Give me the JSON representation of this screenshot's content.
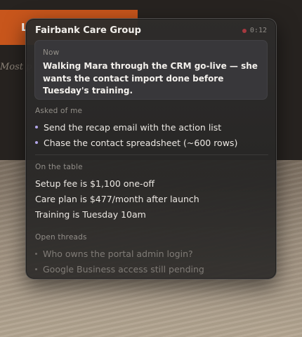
{
  "background": {
    "cta_label": "L",
    "tagline": "Most p"
  },
  "panel": {
    "title": "Fairbank Care Group",
    "timer": "0:12",
    "recording_color": "#a6393f",
    "accent_bullet_color": "#b2a6e8",
    "now": {
      "label": "Now",
      "text": "Walking Mara through the CRM go-live — she wants the contact import done before Tuesday's training."
    },
    "asked_of_me": {
      "label": "Asked of me",
      "items": [
        "Send the recap email with the action list",
        "Chase the contact spreadsheet (~600 rows)"
      ]
    },
    "on_the_table": {
      "label": "On the table",
      "items": [
        "Setup fee is $1,100 one-off",
        "Care plan is $477/month after launch",
        "Training is Tuesday 10am"
      ]
    },
    "open_threads": {
      "label": "Open threads",
      "items": [
        "Who owns the portal admin login?",
        "Google Business access still pending"
      ]
    }
  }
}
